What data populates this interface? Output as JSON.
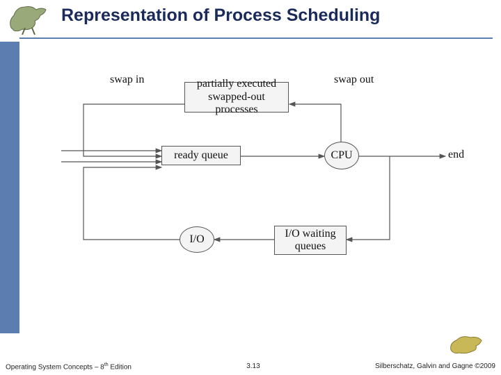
{
  "slide": {
    "title": "Representation of Process Scheduling",
    "footer_left_prefix": "Operating System Concepts – 8",
    "footer_left_suffix": " Edition",
    "footer_left_sup": "th",
    "page_number": "3.13",
    "footer_right": "Silberschatz, Galvin and Gagne ©2009"
  },
  "diagram": {
    "labels": {
      "swap_in": "swap in",
      "swap_out": "swap out",
      "end": "end"
    },
    "boxes": {
      "partially_executed": "partially executed\nswapped-out processes",
      "ready_queue": "ready queue",
      "io_waiting": "I/O waiting\nqueues"
    },
    "ovals": {
      "cpu": "CPU",
      "io": "I/O"
    }
  },
  "icons": {
    "dino_left": "dinosaur-running-icon",
    "dino_right": "dinosaur-standing-icon"
  }
}
